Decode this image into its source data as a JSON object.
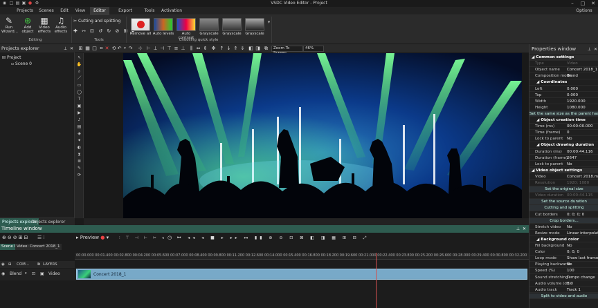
{
  "window": {
    "title": "VSDC Video Editor - Project",
    "options": "Options"
  },
  "menu": [
    "Projects",
    "Scenes",
    "Edit",
    "View",
    "Editor",
    "Export project",
    "Tools",
    "Activation"
  ],
  "ribbon": {
    "editing": {
      "buttons": [
        "Run Wizard...",
        "Add object",
        "Video effects",
        "Audio effects"
      ],
      "group_label": "Editing"
    },
    "tools": {
      "cutting": "Cutting and splitting",
      "group_label": "Tools"
    },
    "quickstyle": {
      "styles": [
        "Remove all",
        "Auto levels",
        "Auto contrast",
        "Grayscale",
        "Grayscale",
        "Grayscale"
      ],
      "group_label": "Choosing quick style"
    }
  },
  "toolbar": {
    "zoom": "Zoom To Screen",
    "percent": "46%"
  },
  "projects_panel": {
    "title": "Projects explorer",
    "tree": [
      "Project",
      "Scene 0"
    ],
    "tabs": [
      "Projects explorer",
      "Objects explorer"
    ]
  },
  "properties": {
    "title": "Properties window",
    "rows": [
      {
        "t": "sec",
        "k": "Common settings"
      },
      {
        "t": "dim",
        "k": "Type",
        "v": "Video"
      },
      {
        "t": "row",
        "k": "Object name",
        "v": "Concert 2018_1"
      },
      {
        "t": "row",
        "k": "Composition mode",
        "v": "Blend"
      },
      {
        "t": "sub",
        "k": "Coordinates"
      },
      {
        "t": "row",
        "k": "Left",
        "v": "0.000"
      },
      {
        "t": "row",
        "k": "Top",
        "v": "0.000"
      },
      {
        "t": "row",
        "k": "Width",
        "v": "1920.000"
      },
      {
        "t": "row",
        "k": "Height",
        "v": "1080.000"
      },
      {
        "t": "btn",
        "k": "Set the same size as the parent has"
      },
      {
        "t": "sub",
        "k": "Object creation time"
      },
      {
        "t": "row",
        "k": "Time (ms)",
        "v": "00:00:00.000"
      },
      {
        "t": "row",
        "k": "Time (frame)",
        "v": "0"
      },
      {
        "t": "row",
        "k": "Lock to parent",
        "v": "No"
      },
      {
        "t": "sub",
        "k": "Object drawing duration"
      },
      {
        "t": "row",
        "k": "Duration (ms)",
        "v": "00:00:44.116"
      },
      {
        "t": "row",
        "k": "Duration (frame)",
        "v": "2647"
      },
      {
        "t": "row",
        "k": "Lock to parent",
        "v": "No"
      },
      {
        "t": "sec",
        "k": "Video object settings"
      },
      {
        "t": "row",
        "k": "Video",
        "v": "Concert 2018.mp4"
      },
      {
        "t": "dim",
        "k": "Resolution",
        "v": "1920; 1080"
      },
      {
        "t": "btn",
        "k": "Set the original size"
      },
      {
        "t": "dim",
        "k": "Video duration",
        "v": "00:00:44.115"
      },
      {
        "t": "btn",
        "k": "Set the source duration"
      },
      {
        "t": "btn",
        "k": "Cutting and splitting"
      },
      {
        "t": "row",
        "k": "Cut borders",
        "v": "0; 0; 0; 0"
      },
      {
        "t": "btn",
        "k": "Crop borders..."
      },
      {
        "t": "row",
        "k": "Stretch video",
        "v": "No"
      },
      {
        "t": "row",
        "k": "Resize mode",
        "v": "Linear interpolation"
      },
      {
        "t": "sub",
        "k": "Background color"
      },
      {
        "t": "row",
        "k": "Fill background",
        "v": "No"
      },
      {
        "t": "row",
        "k": "Color",
        "v": "0; 0; 0"
      },
      {
        "t": "row",
        "k": "Loop mode",
        "v": "Show last frame at"
      },
      {
        "t": "row",
        "k": "Playing backwards",
        "v": "No"
      },
      {
        "t": "row",
        "k": "Speed (%)",
        "v": "100"
      },
      {
        "t": "row",
        "k": "Sound stretching",
        "v": "Tempo change"
      },
      {
        "t": "row",
        "k": "Audio volume (dB)",
        "v": "0.0"
      },
      {
        "t": "row",
        "k": "Audio track",
        "v": "Track 1"
      },
      {
        "t": "btn",
        "k": "Split to video and audio"
      }
    ]
  },
  "timeline": {
    "title": "Timeline window",
    "preview": "Preview",
    "scene_tabs": [
      "Scene 0",
      "Video: Concert 2018_1"
    ],
    "layer_row": {
      "com": "COM...",
      "layers": "LAYERS"
    },
    "track": {
      "blend": "Blend",
      "type": "Video"
    },
    "clip": "Concert 2018_1",
    "ticks": [
      "00:00.000",
      "00:01.400",
      "00:02.800",
      "00:04.200",
      "00:05.600",
      "00:07.000",
      "00:08.400",
      "00:09.800",
      "00:11.200",
      "00:12.600",
      "00:14.000",
      "00:15.400",
      "00:16.800",
      "00:18.200",
      "00:19.600",
      "00:21.000",
      "00:22.400",
      "00:23.800",
      "00:25.200",
      "00:26.600",
      "00:28.000",
      "00:29.400",
      "00:30.800",
      "00:32.200"
    ]
  },
  "colors": {
    "accent": "#2e5c50",
    "clip": "#78a9c8",
    "playhead": "#d05050"
  }
}
